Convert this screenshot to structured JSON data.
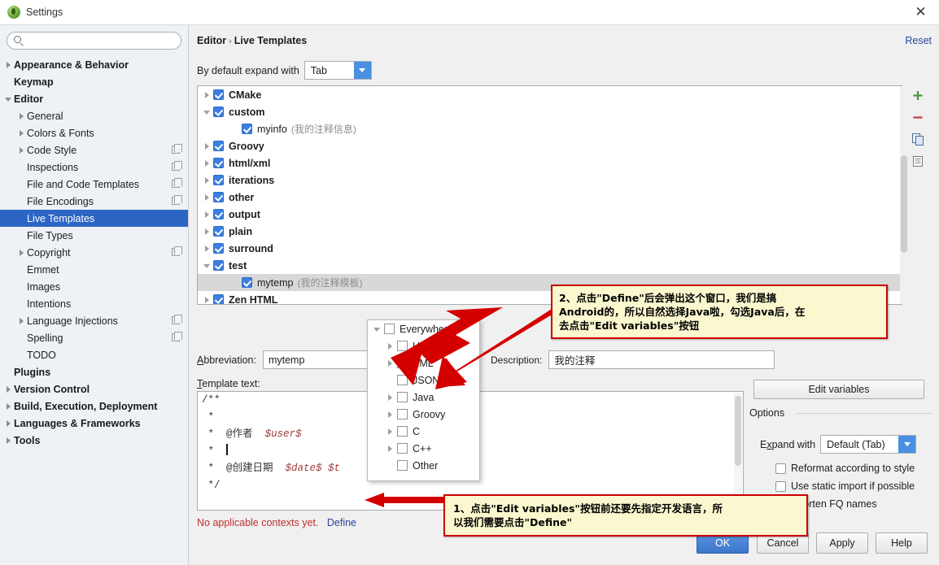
{
  "window": {
    "title": "Settings",
    "app_icon": "android-studio-icon",
    "close_label": "✕"
  },
  "sidebar": {
    "search": {
      "value": "",
      "placeholder": "",
      "icon": "search-icon"
    },
    "items": [
      {
        "label": "Appearance & Behavior",
        "bold": true,
        "indent": 0,
        "arrow": "closed",
        "selected": false,
        "config": false
      },
      {
        "label": "Keymap",
        "bold": true,
        "indent": 0,
        "arrow": "none",
        "selected": false,
        "config": false
      },
      {
        "label": "Editor",
        "bold": true,
        "indent": 0,
        "arrow": "open",
        "selected": false,
        "config": false
      },
      {
        "label": "General",
        "bold": false,
        "indent": 1,
        "arrow": "closed",
        "selected": false,
        "config": false
      },
      {
        "label": "Colors & Fonts",
        "bold": false,
        "indent": 1,
        "arrow": "closed",
        "selected": false,
        "config": false
      },
      {
        "label": "Code Style",
        "bold": false,
        "indent": 1,
        "arrow": "closed",
        "selected": false,
        "config": true
      },
      {
        "label": "Inspections",
        "bold": false,
        "indent": 1,
        "arrow": "none",
        "selected": false,
        "config": true
      },
      {
        "label": "File and Code Templates",
        "bold": false,
        "indent": 1,
        "arrow": "none",
        "selected": false,
        "config": true
      },
      {
        "label": "File Encodings",
        "bold": false,
        "indent": 1,
        "arrow": "none",
        "selected": false,
        "config": true
      },
      {
        "label": "Live Templates",
        "bold": false,
        "indent": 1,
        "arrow": "none",
        "selected": true,
        "config": false
      },
      {
        "label": "File Types",
        "bold": false,
        "indent": 1,
        "arrow": "none",
        "selected": false,
        "config": false
      },
      {
        "label": "Copyright",
        "bold": false,
        "indent": 1,
        "arrow": "closed",
        "selected": false,
        "config": true
      },
      {
        "label": "Emmet",
        "bold": false,
        "indent": 1,
        "arrow": "none",
        "selected": false,
        "config": false
      },
      {
        "label": "Images",
        "bold": false,
        "indent": 1,
        "arrow": "none",
        "selected": false,
        "config": false
      },
      {
        "label": "Intentions",
        "bold": false,
        "indent": 1,
        "arrow": "none",
        "selected": false,
        "config": false
      },
      {
        "label": "Language Injections",
        "bold": false,
        "indent": 1,
        "arrow": "closed",
        "selected": false,
        "config": true
      },
      {
        "label": "Spelling",
        "bold": false,
        "indent": 1,
        "arrow": "none",
        "selected": false,
        "config": true
      },
      {
        "label": "TODO",
        "bold": false,
        "indent": 1,
        "arrow": "none",
        "selected": false,
        "config": false
      },
      {
        "label": "Plugins",
        "bold": true,
        "indent": 0,
        "arrow": "none",
        "selected": false,
        "config": false
      },
      {
        "label": "Version Control",
        "bold": true,
        "indent": 0,
        "arrow": "closed",
        "selected": false,
        "config": false
      },
      {
        "label": "Build, Execution, Deployment",
        "bold": true,
        "indent": 0,
        "arrow": "closed",
        "selected": false,
        "config": false
      },
      {
        "label": "Languages & Frameworks",
        "bold": true,
        "indent": 0,
        "arrow": "closed",
        "selected": false,
        "config": false
      },
      {
        "label": "Tools",
        "bold": true,
        "indent": 0,
        "arrow": "closed",
        "selected": false,
        "config": false
      }
    ]
  },
  "header": {
    "breadcrumb_root": "Editor",
    "breadcrumb_sep": "›",
    "breadcrumb_leaf": "Live Templates",
    "reset_label": "Reset",
    "expand_label": "By default expand with",
    "expand_value": "Tab"
  },
  "template_tree": {
    "rows": [
      {
        "name": "CMake",
        "desc": "",
        "arrow": "closed",
        "checked": true,
        "indent": 1,
        "bold": true,
        "highlight": false
      },
      {
        "name": "custom",
        "desc": "",
        "arrow": "open",
        "checked": true,
        "indent": 1,
        "bold": true,
        "highlight": false
      },
      {
        "name": "myinfo",
        "desc": "(我的注释信息)",
        "arrow": "none",
        "checked": true,
        "indent": 2,
        "bold": false,
        "highlight": false
      },
      {
        "name": "Groovy",
        "desc": "",
        "arrow": "closed",
        "checked": true,
        "indent": 1,
        "bold": true,
        "highlight": false
      },
      {
        "name": "html/xml",
        "desc": "",
        "arrow": "closed",
        "checked": true,
        "indent": 1,
        "bold": true,
        "highlight": false
      },
      {
        "name": "iterations",
        "desc": "",
        "arrow": "closed",
        "checked": true,
        "indent": 1,
        "bold": true,
        "highlight": false
      },
      {
        "name": "other",
        "desc": "",
        "arrow": "closed",
        "checked": true,
        "indent": 1,
        "bold": true,
        "highlight": false
      },
      {
        "name": "output",
        "desc": "",
        "arrow": "closed",
        "checked": true,
        "indent": 1,
        "bold": true,
        "highlight": false
      },
      {
        "name": "plain",
        "desc": "",
        "arrow": "closed",
        "checked": true,
        "indent": 1,
        "bold": true,
        "highlight": false
      },
      {
        "name": "surround",
        "desc": "",
        "arrow": "closed",
        "checked": true,
        "indent": 1,
        "bold": true,
        "highlight": false
      },
      {
        "name": "test",
        "desc": "",
        "arrow": "open",
        "checked": true,
        "indent": 1,
        "bold": true,
        "highlight": false
      },
      {
        "name": "mytemp",
        "desc": "(我的注释模板)",
        "arrow": "none",
        "checked": true,
        "indent": 2,
        "bold": false,
        "highlight": true
      },
      {
        "name": "Zen HTML",
        "desc": "",
        "arrow": "closed",
        "checked": true,
        "indent": 1,
        "bold": true,
        "highlight": false
      }
    ],
    "toolbar": [
      {
        "icon": "plus-icon",
        "name": "add-template-button"
      },
      {
        "icon": "minus-icon",
        "name": "remove-template-button"
      },
      {
        "icon": "copy-icon",
        "name": "duplicate-template-button"
      },
      {
        "icon": "list-icon",
        "name": "change-context-button"
      }
    ]
  },
  "editor": {
    "abbreviation_label": "Abbreviation:",
    "abbreviation_value": "mytemp",
    "description_label": "Description:",
    "description_value": "我的注释",
    "template_text_label": "Template text:",
    "template_lines": [
      {
        "segments": [
          {
            "t": "/**",
            "k": "c"
          }
        ]
      },
      {
        "segments": [
          {
            "t": " *",
            "k": "c"
          }
        ]
      },
      {
        "segments": [
          {
            "t": " *  @作者  ",
            "k": "c"
          },
          {
            "t": "$user$",
            "k": "var"
          }
        ]
      },
      {
        "segments": [
          {
            "t": " *  ",
            "k": "c"
          },
          {
            "t": "",
            "k": "caret"
          }
        ]
      },
      {
        "segments": [
          {
            "t": " *  @创建日期  ",
            "k": "c"
          },
          {
            "t": "$date$ $t",
            "k": "var"
          }
        ]
      },
      {
        "segments": [
          {
            "t": " */",
            "k": "c"
          }
        ]
      }
    ],
    "context_note": "No applicable contexts yet.",
    "define_link": "Define"
  },
  "context_popup": {
    "rows": [
      {
        "label": "Everywhere",
        "indent": 0,
        "arrow": "open",
        "checked": false
      },
      {
        "label": "HTML",
        "indent": 1,
        "arrow": "closed",
        "checked": false
      },
      {
        "label": "XML",
        "indent": 1,
        "arrow": "closed",
        "checked": false
      },
      {
        "label": "JSON",
        "indent": 1,
        "arrow": "none",
        "checked": false
      },
      {
        "label": "Java",
        "indent": 1,
        "arrow": "closed",
        "checked": false
      },
      {
        "label": "Groovy",
        "indent": 1,
        "arrow": "closed",
        "checked": false
      },
      {
        "label": "C",
        "indent": 1,
        "arrow": "closed",
        "checked": false
      },
      {
        "label": "C++",
        "indent": 1,
        "arrow": "closed",
        "checked": false
      },
      {
        "label": "Other",
        "indent": 1,
        "arrow": "none",
        "checked": false
      }
    ]
  },
  "options": {
    "edit_variables_label": "Edit variables",
    "legend": "Options",
    "expand_with_label": "Expand with",
    "expand_with_value": "Default (Tab)",
    "checkboxes": [
      {
        "label": "Reformat according to style",
        "checked": false
      },
      {
        "label": "Use static import if possible",
        "checked": false
      },
      {
        "label": "Shorten FQ names",
        "checked": true
      }
    ]
  },
  "footer": {
    "ok": "OK",
    "cancel": "Cancel",
    "apply": "Apply",
    "help": "Help"
  },
  "annotations": {
    "callout1": [
      "1、点击\"Edit variables\"按钮前还要先指定开发语言，所",
      "以我们需要点击\"Define\""
    ],
    "callout2": [
      "2、点击\"Define\"后会弹出这个窗口，我们是搞",
      "Android的，所以自然选择Java啦，勾选Java后，在",
      "去点击\"Edit variables\"按钮"
    ],
    "arrow_color": "#d40000"
  },
  "colors": {
    "accent_blue": "#2c65c4",
    "checkbox_blue": "#3b7fe0",
    "callout_bg": "#fbf8cf",
    "callout_border": "#cc0000",
    "error_red": "#c03030",
    "link_blue": "#2b43a0"
  }
}
